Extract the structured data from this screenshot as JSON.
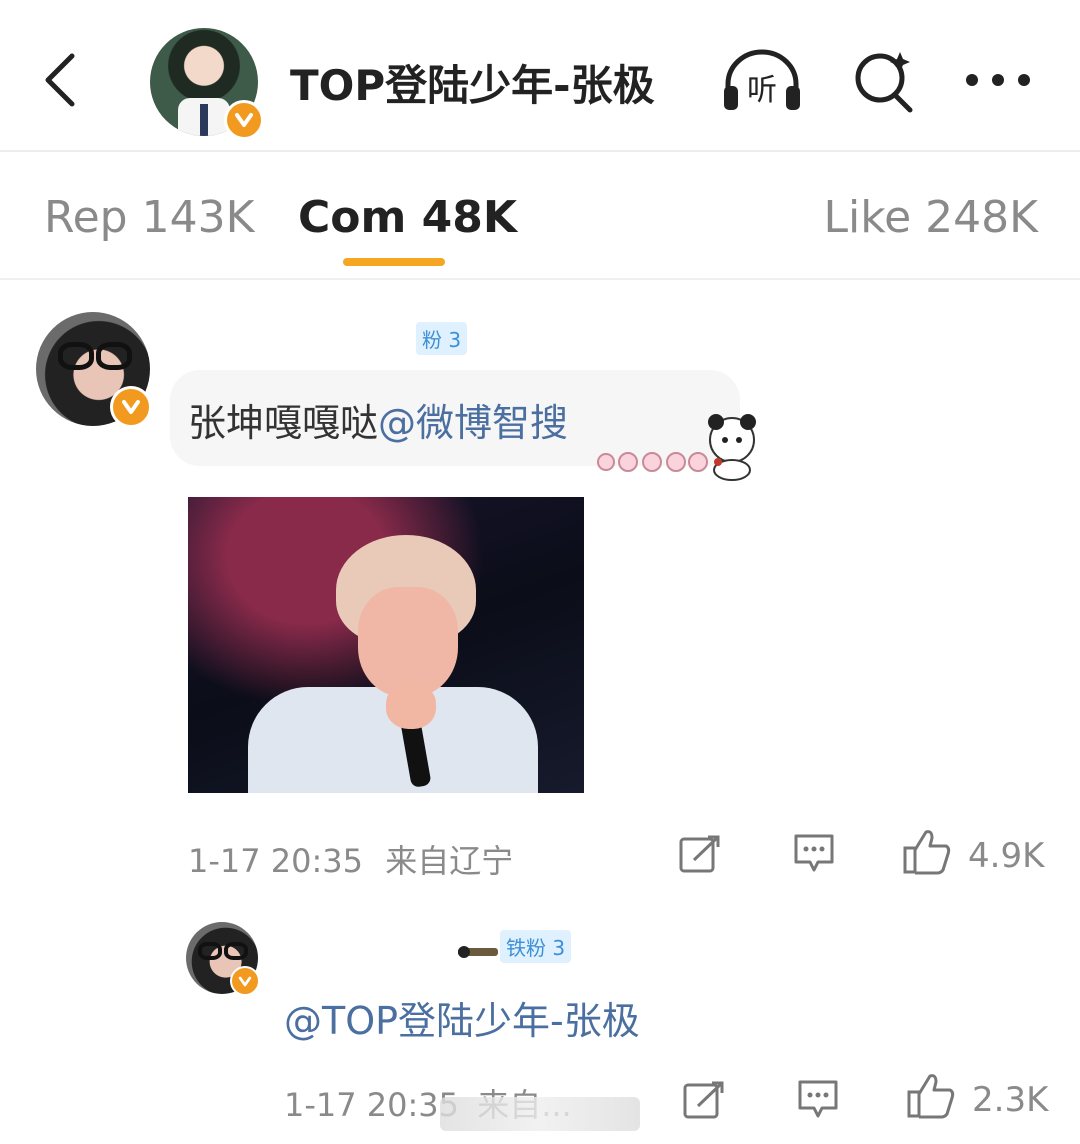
{
  "header": {
    "title": "TOP登陆少年-张极"
  },
  "tabs": {
    "reposts": "Rep 143K",
    "comments": "Com 48K",
    "likes": "Like 248K"
  },
  "comment": {
    "fan_badge": "粉 3",
    "text": "张坤嘎嘎哒",
    "mention": "@微博智搜",
    "time": "1-17 20:35",
    "location": "来自辽宁",
    "like_count": "4.9K"
  },
  "reply": {
    "fan_badge": "铁粉 3",
    "text": "@TOP登陆少年-张极",
    "time": "1-17 20:35",
    "location": "来自...",
    "like_count": "2.3K"
  },
  "colors": {
    "accent": "#f5a623",
    "verified": "#f29a1f",
    "mention": "#4a6fa0"
  }
}
